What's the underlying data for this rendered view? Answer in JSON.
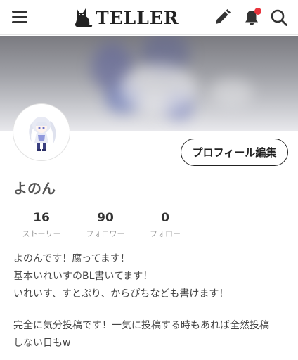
{
  "header": {
    "brand": "TELLER",
    "icons": [
      "menu-icon",
      "cat-logo-icon",
      "pencil-icon",
      "bell-icon",
      "search-icon"
    ],
    "notification_dot_color": "#e8343d"
  },
  "profile": {
    "username": "よのん",
    "edit_button": "プロフィール編集",
    "stats": [
      {
        "value": "16",
        "label": "ストーリー"
      },
      {
        "value": "90",
        "label": "フォロワー"
      },
      {
        "value": "0",
        "label": "フォロー"
      }
    ],
    "bio": [
      "よのんです！腐ってます！",
      "基本いれいすのBL書いてます！",
      "いれいす、すとぷり、からぴちなども書けます！",
      "",
      "完全に気分投稿です！一気に投稿する時もあれば全然投稿",
      "しない日もw"
    ]
  }
}
